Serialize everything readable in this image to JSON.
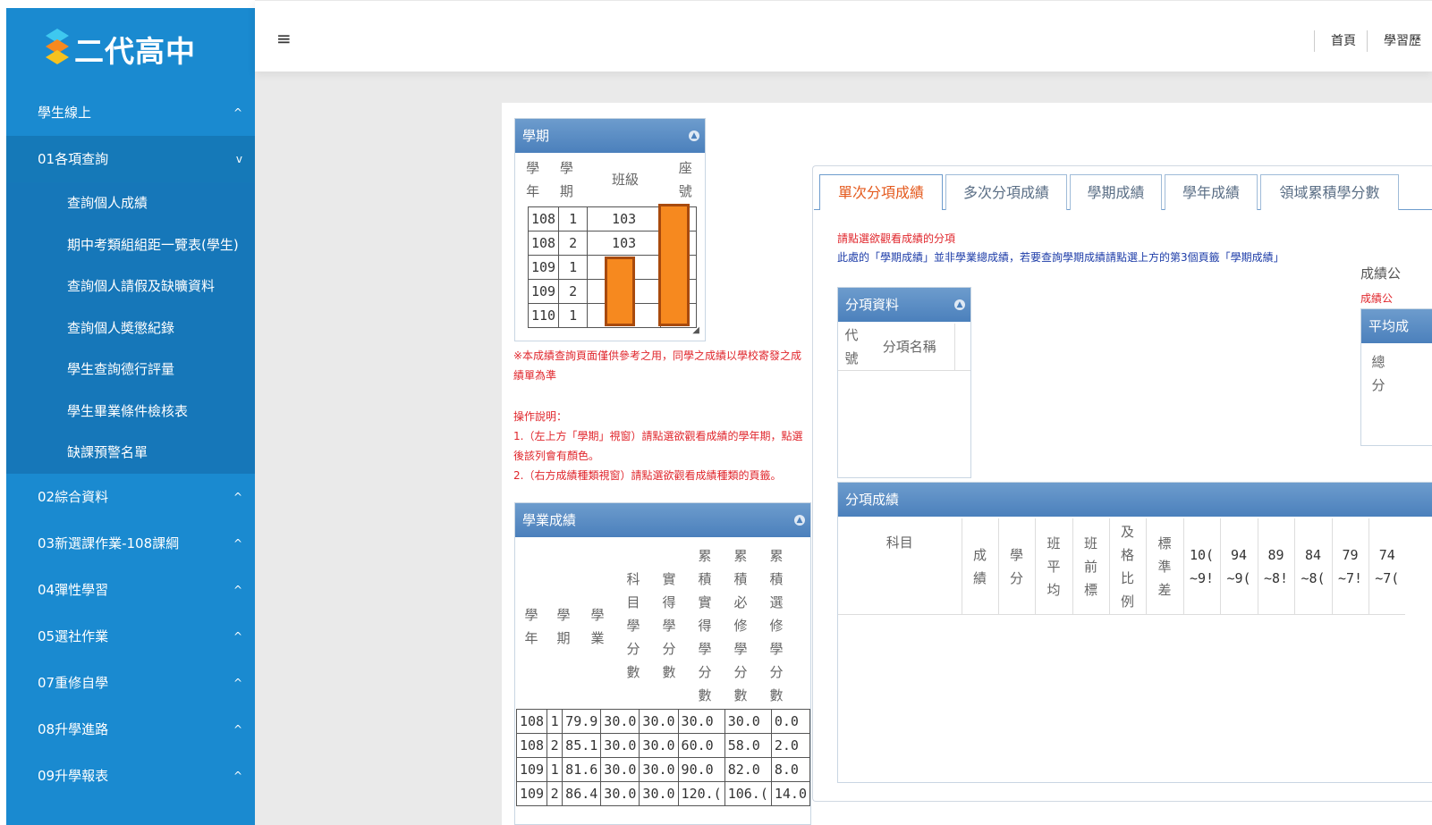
{
  "app": {
    "title": "二代高中"
  },
  "topbar": {
    "menu_icon": "≡",
    "links": [
      "首頁",
      "學習歷"
    ]
  },
  "sidebar": {
    "top": {
      "label": "學生線上",
      "arrow": "^"
    },
    "section01": {
      "label": "01各項查詢",
      "arrow": "v"
    },
    "sub": [
      "查詢個人成績",
      "期中考類組組距一覽表(學生)",
      "查詢個人請假及缺曠資料",
      "查詢個人奬懲紀錄",
      "學生查詢德行評量",
      "學生畢業條件檢核表",
      "缺課預警名單"
    ],
    "groups": [
      {
        "label": "02綜合資料",
        "arrow": "^"
      },
      {
        "label": "03新選課作業-108課綱",
        "arrow": "^"
      },
      {
        "label": "04彈性學習",
        "arrow": "^"
      },
      {
        "label": "05選社作業",
        "arrow": "^"
      },
      {
        "label": "07重修自學",
        "arrow": "^"
      },
      {
        "label": "08升學進路",
        "arrow": "^"
      },
      {
        "label": "09升學報表",
        "arrow": "^"
      }
    ]
  },
  "semester_window": {
    "title": "學期",
    "headers": [
      "學\n年",
      "學\n期",
      "班級",
      "座\n號"
    ],
    "rows": [
      [
        "108",
        "1",
        "103",
        ""
      ],
      [
        "108",
        "2",
        "103",
        ""
      ],
      [
        "109",
        "1",
        "",
        ""
      ],
      [
        "109",
        "2",
        "",
        ""
      ],
      [
        "110",
        "1",
        "",
        ""
      ]
    ]
  },
  "notice": "※本成績查詢頁面僅供參考之用，同學之成績以學校寄發之成績單為準",
  "instructions": {
    "title": "操作說明：",
    "line1": "1.（左上方「學期」視窗）請點選欲觀看成績的學年期，點選後該列會有顏色。",
    "line2": "2.（右方成績種類視窗）請點選欲觀看成績種類的頁籤。"
  },
  "academic_window": {
    "title": "學業成績",
    "headers": [
      "學\n年",
      "學\n期",
      "學\n業",
      "科\n目\n學\n分\n數",
      "實\n得\n學\n分\n數",
      "累\n積\n實\n得\n學\n分\n數",
      "累\n積\n必\n修\n學\n分\n數",
      "累\n積\n選\n修\n學\n分\n數"
    ],
    "rows": [
      [
        "108",
        "1",
        "79.9",
        "30.0",
        "30.0",
        "30.0",
        "30.0",
        "0.0"
      ],
      [
        "108",
        "2",
        "85.1",
        "30.0",
        "30.0",
        "60.0",
        "58.0",
        "2.0"
      ],
      [
        "109",
        "1",
        "81.6",
        "30.0",
        "30.0",
        "90.0",
        "82.0",
        "8.0"
      ],
      [
        "109",
        "2",
        "86.4",
        "30.0",
        "30.0",
        "120.(",
        "106.(",
        "14.0"
      ]
    ]
  },
  "tabs": [
    "單次分項成績",
    "多次分項成績",
    "學期成績",
    "學年成績",
    "領域累積學分數"
  ],
  "tab_content": {
    "prompt": "請點選欲觀看成績的分項",
    "note": "此處的「學期成績」並非學業總成績，若要查詢學期成績請點選上方的第3個頁籤「學期成績」",
    "right_label1": "成績公",
    "right_label2": "成績公"
  },
  "item_info_window": {
    "title": "分項資料",
    "headers": [
      "代\n號",
      "分項名稱"
    ]
  },
  "average_window": {
    "title": "平均成",
    "header": "總\n分"
  },
  "item_score_window": {
    "title": "分項成績",
    "headers": [
      "科目",
      "成\n績",
      "學\n分",
      "班\n平\n均",
      "班\n前\n標",
      "及\n格\n比\n例",
      "標\n準\n差",
      "10(\n~9!",
      "94\n~9(",
      "89\n~8!",
      "84\n~8(",
      "79\n~7!",
      "74\n~7("
    ]
  },
  "colors": {
    "sidebar": "#1a8ad0",
    "window_header": "#4b80bc",
    "notice": "#e0262c",
    "active_tab": "#e45a1e",
    "highlight": "#f6891f"
  }
}
